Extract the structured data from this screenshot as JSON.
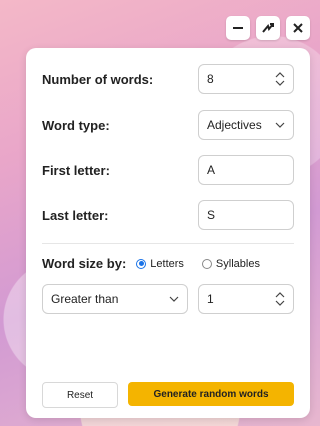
{
  "controls": {
    "minimize": "minimize-icon",
    "shuffle": "shuffle-icon",
    "close": "close-icon"
  },
  "form": {
    "num_words": {
      "label": "Number of words:",
      "value": "8"
    },
    "word_type": {
      "label": "Word type:",
      "value": "Adjectives"
    },
    "first_letter": {
      "label": "First letter:",
      "value": "A"
    },
    "last_letter": {
      "label": "Last letter:",
      "value": "S"
    },
    "word_size": {
      "label": "Word size by:",
      "options": [
        "Letters",
        "Syllables"
      ],
      "selected": "Letters",
      "comparison": "Greater than",
      "value": "1"
    }
  },
  "buttons": {
    "reset": "Reset",
    "generate": "Generate random words"
  },
  "colors": {
    "accent": "#f4b400",
    "radio": "#1a73e8"
  }
}
